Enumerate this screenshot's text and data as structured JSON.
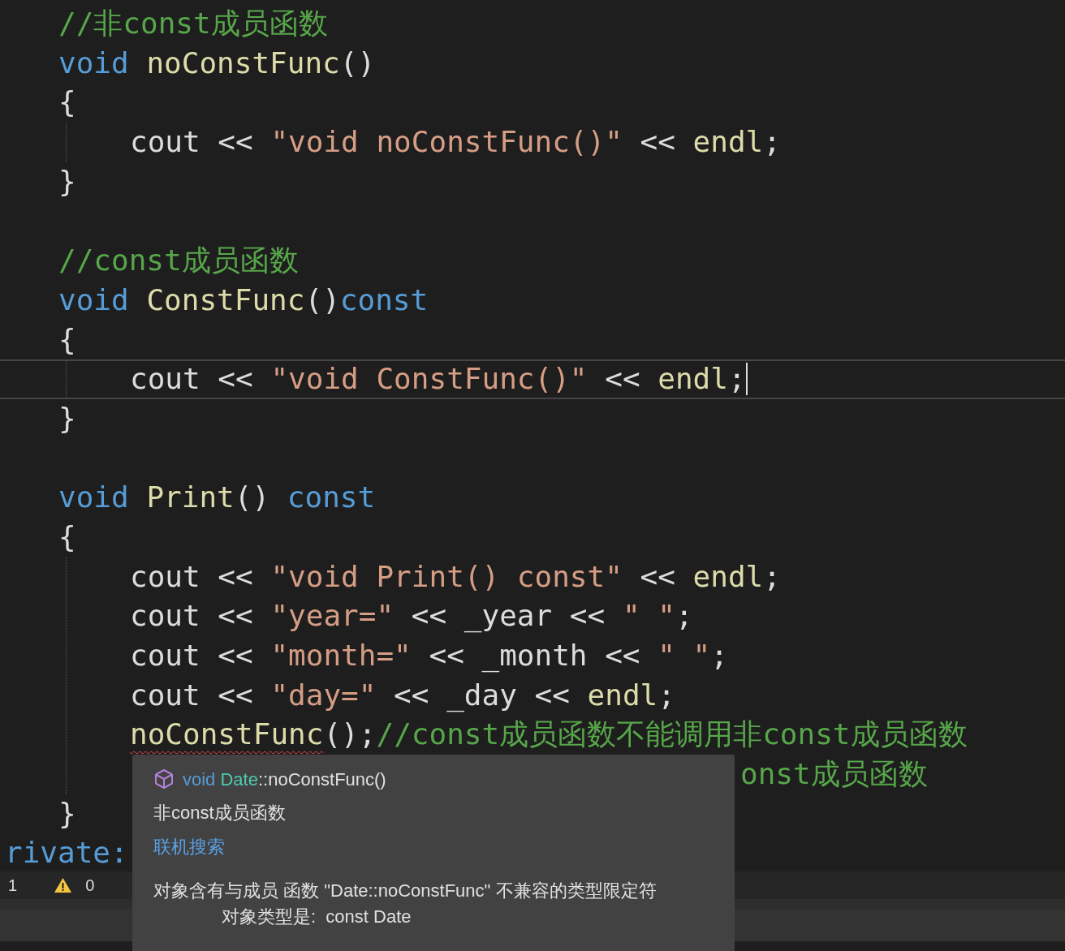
{
  "editor": {
    "lines": [
      {
        "kind": "code",
        "tokens": [
          {
            "kind": "comment",
            "text": "//非const成员函数"
          }
        ]
      },
      {
        "kind": "code",
        "tokens": [
          {
            "kind": "keyword",
            "text": "void "
          },
          {
            "kind": "function",
            "text": "noConstFunc"
          },
          {
            "kind": "plain",
            "text": "()"
          }
        ]
      },
      {
        "kind": "code",
        "tokens": [
          {
            "kind": "plain",
            "text": "{"
          }
        ],
        "children": [
          {
            "kind": "code",
            "tokens": [
              {
                "kind": "plain",
                "text": "cout << "
              },
              {
                "kind": "string",
                "text": "\"void noConstFunc()\""
              },
              {
                "kind": "plain",
                "text": " << "
              },
              {
                "kind": "function",
                "text": "endl"
              },
              {
                "kind": "plain",
                "text": ";"
              }
            ]
          }
        ]
      },
      {
        "kind": "code",
        "tokens": [
          {
            "kind": "plain",
            "text": "}"
          }
        ]
      },
      {
        "kind": "blank"
      },
      {
        "kind": "code",
        "tokens": [
          {
            "kind": "comment",
            "text": "//const成员函数"
          }
        ]
      },
      {
        "kind": "code",
        "tokens": [
          {
            "kind": "keyword",
            "text": "void "
          },
          {
            "kind": "function",
            "text": "ConstFunc"
          },
          {
            "kind": "plain",
            "text": "()"
          },
          {
            "kind": "keyword",
            "text": "const"
          }
        ]
      },
      {
        "kind": "code",
        "tokens": [
          {
            "kind": "plain",
            "text": "{"
          }
        ],
        "children": [
          {
            "kind": "current",
            "tokens": [
              {
                "kind": "plain",
                "text": "cout << "
              },
              {
                "kind": "string",
                "text": "\"void ConstFunc()\""
              },
              {
                "kind": "plain",
                "text": " << "
              },
              {
                "kind": "function",
                "text": "endl"
              },
              {
                "kind": "plain",
                "text": ";"
              }
            ]
          }
        ]
      },
      {
        "kind": "code",
        "tokens": [
          {
            "kind": "plain",
            "text": "}"
          }
        ]
      },
      {
        "kind": "blank"
      },
      {
        "kind": "code",
        "tokens": [
          {
            "kind": "keyword",
            "text": "void "
          },
          {
            "kind": "function",
            "text": "Print"
          },
          {
            "kind": "plain",
            "text": "() "
          },
          {
            "kind": "keyword",
            "text": "const"
          }
        ]
      },
      {
        "kind": "code",
        "tokens": [
          {
            "kind": "plain",
            "text": "{"
          }
        ],
        "children": [
          {
            "kind": "code",
            "tokens": [
              {
                "kind": "plain",
                "text": "cout << "
              },
              {
                "kind": "string",
                "text": "\"void Print() const\""
              },
              {
                "kind": "plain",
                "text": " << "
              },
              {
                "kind": "function",
                "text": "endl"
              },
              {
                "kind": "plain",
                "text": ";"
              }
            ]
          },
          {
            "kind": "code",
            "tokens": [
              {
                "kind": "plain",
                "text": "cout << "
              },
              {
                "kind": "string",
                "text": "\"year=\""
              },
              {
                "kind": "plain",
                "text": " << _year << "
              },
              {
                "kind": "string",
                "text": "\" \""
              },
              {
                "kind": "plain",
                "text": ";"
              }
            ]
          },
          {
            "kind": "code",
            "tokens": [
              {
                "kind": "plain",
                "text": "cout << "
              },
              {
                "kind": "string",
                "text": "\"month=\""
              },
              {
                "kind": "plain",
                "text": " << _month << "
              },
              {
                "kind": "string",
                "text": "\" \""
              },
              {
                "kind": "plain",
                "text": ";"
              }
            ]
          },
          {
            "kind": "code",
            "tokens": [
              {
                "kind": "plain",
                "text": "cout << "
              },
              {
                "kind": "string",
                "text": "\"day=\""
              },
              {
                "kind": "plain",
                "text": " << _day << "
              },
              {
                "kind": "function",
                "text": "endl"
              },
              {
                "kind": "plain",
                "text": ";"
              }
            ]
          },
          {
            "kind": "code",
            "tokens": [
              {
                "kind": "function",
                "text": "noConstFunc",
                "error": true
              },
              {
                "kind": "plain",
                "text": "();"
              },
              {
                "kind": "comment",
                "text": "//const成员函数不能调用非const成员函数"
              }
            ]
          },
          {
            "kind": "covered",
            "tokens": [
              {
                "kind": "comment",
                "text": "onst成员函数"
              }
            ]
          }
        ]
      },
      {
        "kind": "code",
        "tokens": [
          {
            "kind": "plain",
            "text": "}"
          }
        ]
      },
      {
        "kind": "label",
        "tokens": [
          {
            "kind": "keyword",
            "text": "rivate:"
          }
        ]
      }
    ]
  },
  "status_bar": {
    "errors": "1",
    "warnings": "0"
  },
  "tooltip": {
    "signature": [
      {
        "kind": "keyword",
        "text": "void "
      },
      {
        "kind": "type",
        "text": "Date"
      },
      {
        "kind": "plain",
        "text": "::noConstFunc()"
      }
    ],
    "description": "非const成员函数",
    "link": "联机搜索",
    "message": [
      "对象含有与成员 函数 \"Date::noConstFunc\" 不兼容的类型限定符",
      "对象类型是:  const Date"
    ]
  }
}
